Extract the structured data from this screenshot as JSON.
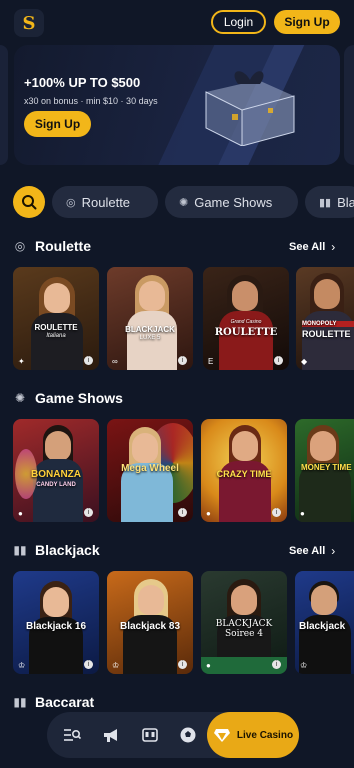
{
  "header": {
    "logo_letter": "S",
    "login_label": "Login",
    "signup_label": "Sign Up"
  },
  "banner": {
    "title": "+100% UP TO $500",
    "subtitle": "x30 on bonus · min $10 · 30 days",
    "button_label": "Sign Up"
  },
  "categories": {
    "items": [
      {
        "label": "Roulette",
        "icon": "roulette-icon"
      },
      {
        "label": "Game Shows",
        "icon": "gameshow-icon"
      },
      {
        "label": "Bla",
        "icon": "cards-icon"
      }
    ]
  },
  "sections": [
    {
      "title": "Roulette",
      "see_all": "See All",
      "tiles": [
        {
          "label": "ROULETTE",
          "sub": "Italiana"
        },
        {
          "label": "BLACKJACK",
          "sub": "LUXE 5"
        },
        {
          "label": "ROULETTE",
          "sub": "Grand Casino"
        },
        {
          "label": "ROULETTE",
          "sub": "MONOPOLY"
        }
      ]
    },
    {
      "title": "Game Shows",
      "see_all": "",
      "tiles": [
        {
          "label": "BONANZA",
          "sub": "CANDY LAND"
        },
        {
          "label": "Mega Wheel",
          "sub": ""
        },
        {
          "label": "CRAZY TIME",
          "sub": ""
        },
        {
          "label": "MONEY TIME",
          "sub": ""
        }
      ]
    },
    {
      "title": "Blackjack",
      "see_all": "See All",
      "tiles": [
        {
          "label": "Blackjack 16",
          "sub": ""
        },
        {
          "label": "Blackjack 83",
          "sub": ""
        },
        {
          "label": "BLACKJACK Soiree 4",
          "sub": ""
        },
        {
          "label": "Blackjack",
          "sub": ""
        }
      ]
    },
    {
      "title": "Baccarat",
      "see_all": ""
    }
  ],
  "bottom_nav": {
    "items": [
      "menu-search-icon",
      "megaphone-icon",
      "slot-machine-icon",
      "sports-ball-icon"
    ],
    "live_casino_label": "Live Casino"
  },
  "colors": {
    "accent": "#f2b619",
    "background": "#101727",
    "pill": "#232b3f"
  }
}
